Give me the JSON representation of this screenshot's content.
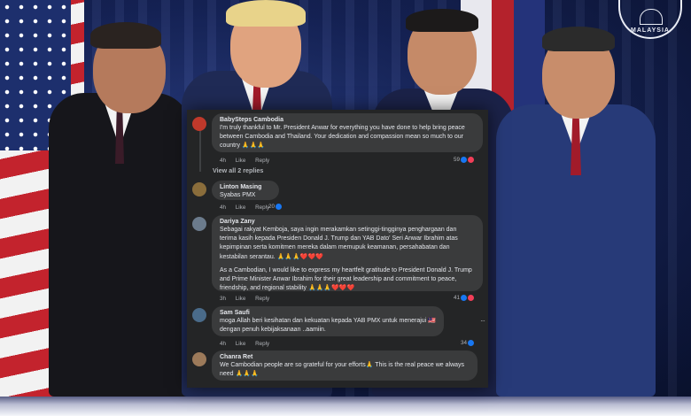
{
  "seal": {
    "text": "MALAYSIA"
  },
  "comments": [
    {
      "author": "BabySteps Cambodia",
      "text": [
        "I'm truly thankful to Mr. President Anwar for everything you have done to help bring peace between Cambodia and Thailand. Your dedication and compassion mean so much to our country 🙏🙏🙏"
      ],
      "time": "4h",
      "like": "Like",
      "reply": "Reply",
      "reactions": "59",
      "avatar_color": "#c0392b"
    },
    {
      "author": "Linton Masing",
      "text": [
        "Syabas PMX"
      ],
      "time": "4h",
      "like": "Like",
      "reply": "Reply",
      "reactions": "20",
      "avatar_color": "#8a6d3b"
    },
    {
      "author": "Dariya Zany",
      "text": [
        "Sebagai rakyat Kemboja, saya ingin merakamkan setinggi-tingginya penghargaan dan terima kasih kepada Presiden Donald J. Trump dan YAB Dato' Seri Anwar Ibrahim atas kepimpinan serta komitmen mereka dalam memupuk keamanan, persahabatan dan kestabilan serantau. 🙏🙏🙏❤️❤️❤️",
        "As a Cambodian, I would like to express my heartfelt gratitude to President Donald J. Trump and Prime Minister Anwar Ibrahim for their great leadership and commitment to peace, friendship, and regional stability 🙏🙏🙏❤️❤️❤️"
      ],
      "time": "3h",
      "like": "Like",
      "reply": "Reply",
      "reactions": "41",
      "avatar_color": "#6b7b8c"
    },
    {
      "author": "Sam Saufi",
      "text": [
        "moga Allah beri kesihatan dan kekuatan kepada YAB PMX untuk menerajui 🇲🇾 dengan penuh kebijaksanaan ..aamiin."
      ],
      "time": "4h",
      "like": "Like",
      "reply": "Reply",
      "reactions": "34",
      "avatar_color": "#4a6b8a"
    },
    {
      "author": "Chanra Ret",
      "text": [
        "We Cambodian people are so grateful for your efforts🙏 This is the real peace we always need 🙏🙏🙏"
      ],
      "avatar_color": "#9c7a5a"
    }
  ],
  "view_replies": "View all 2 replies",
  "more_menu": "···",
  "icons": {
    "like_reaction": "thumbs-up-icon",
    "love_reaction": "heart-icon",
    "more": "more-options-icon"
  },
  "colors": {
    "panel_bg": "#242526",
    "bubble_bg": "#3a3b3c",
    "text": "#e4e6eb",
    "muted": "#b0b3b8",
    "like_blue": "#1877f2",
    "love_red": "#f33e58"
  }
}
